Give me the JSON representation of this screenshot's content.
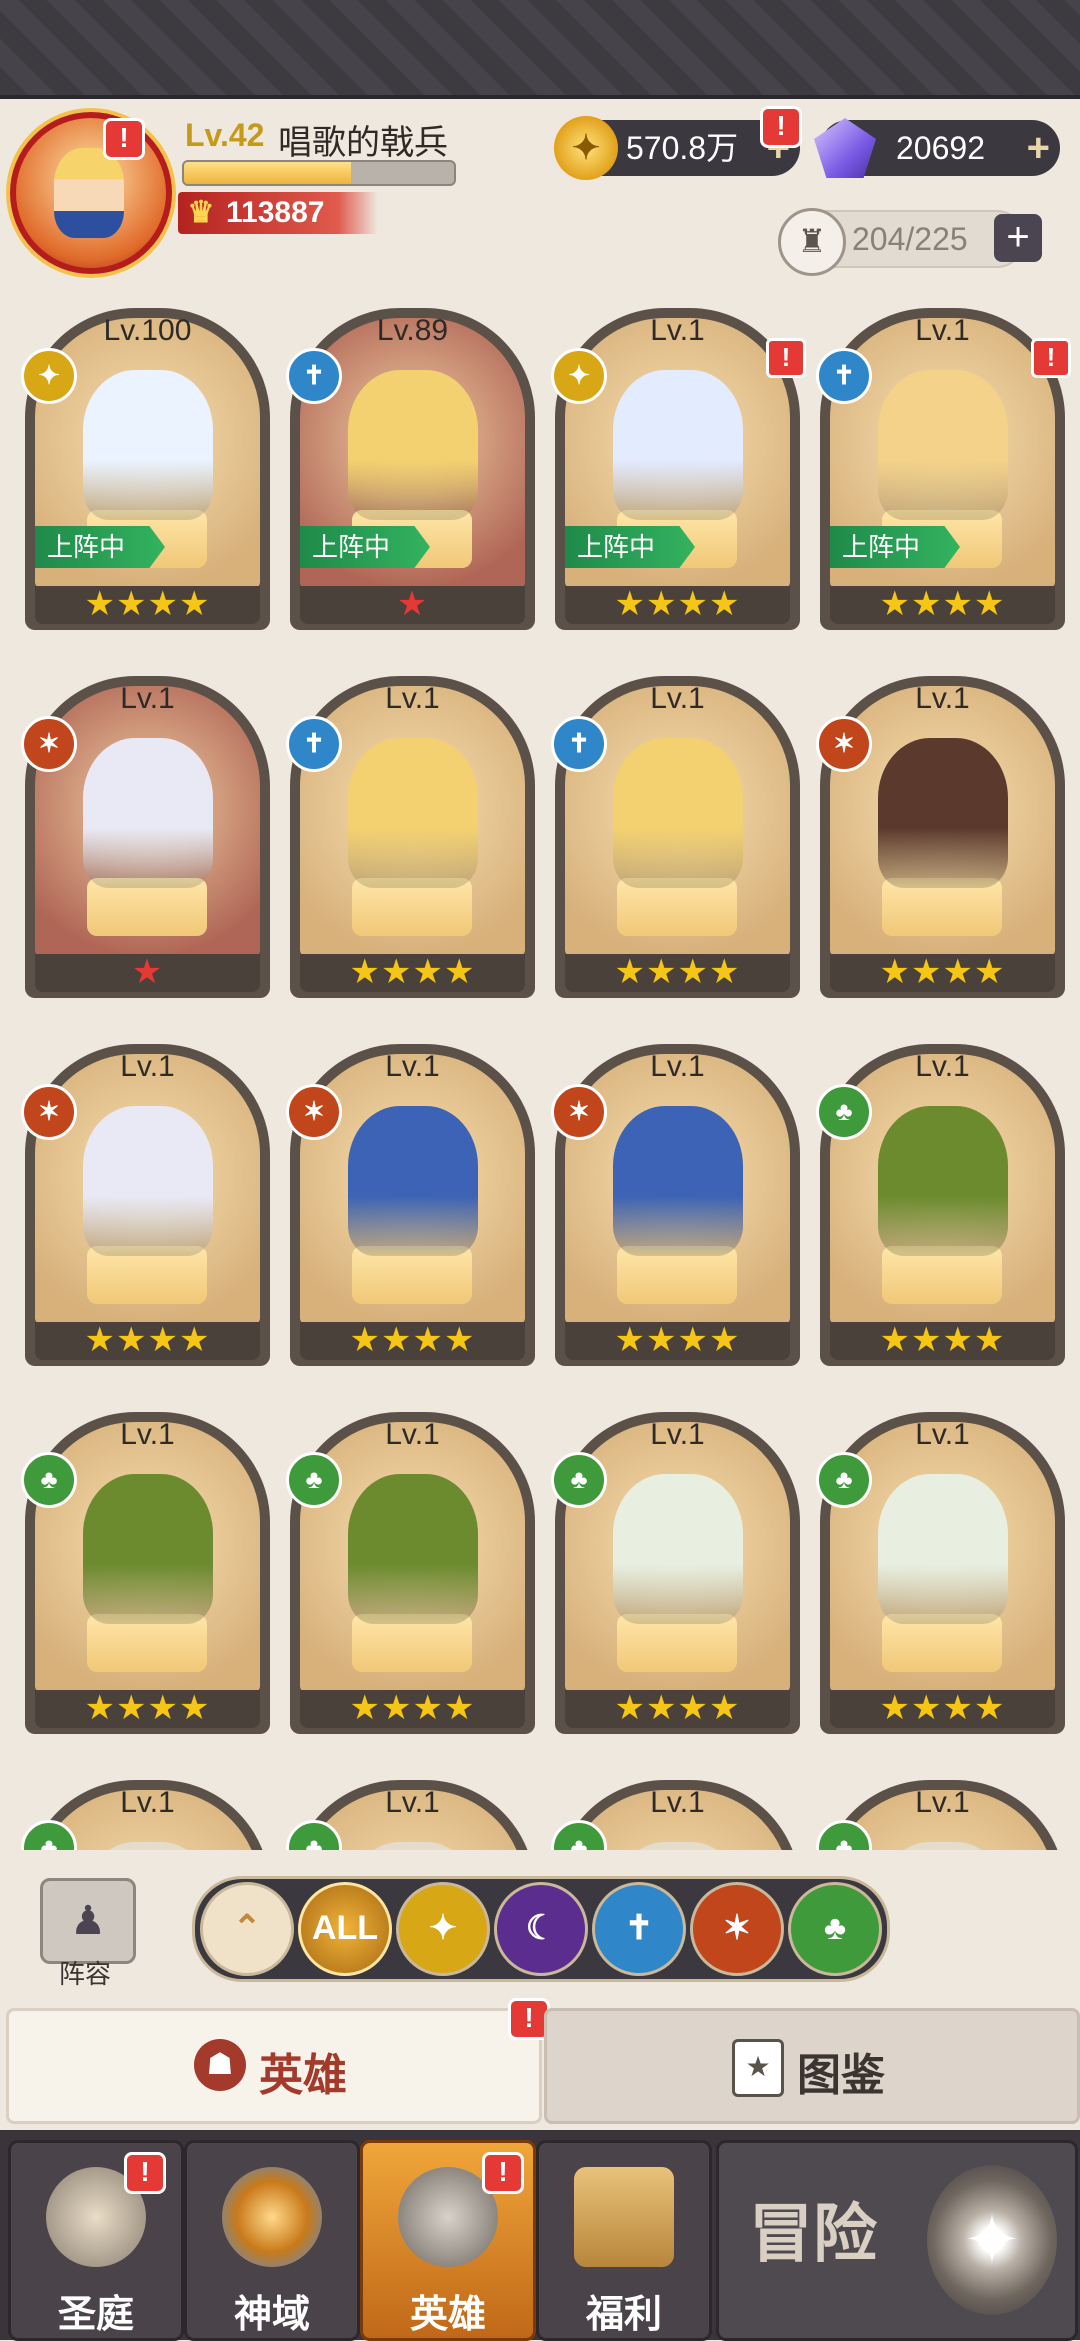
{
  "player": {
    "level": "Lv.42",
    "name": "唱歌的戟兵",
    "xp_fraction": 0.62,
    "power": "113887"
  },
  "resources": {
    "gold": "570.8万",
    "gems": "20692",
    "capacity": "204/225"
  },
  "heroes": [
    {
      "level": "Lv.100",
      "faction": "light",
      "deployed_label": "上阵中",
      "stars": "★★★★",
      "alert": false,
      "color": "#eaf3ff"
    },
    {
      "level": "Lv.89",
      "faction": "order",
      "deployed_label": "上阵中",
      "stars": "★",
      "alert": false,
      "color": "#f3d170"
    },
    {
      "level": "Lv.1",
      "faction": "light",
      "deployed_label": "上阵中",
      "stars": "★★★★",
      "alert": true,
      "color": "#e3ebff"
    },
    {
      "level": "Lv.1",
      "faction": "order",
      "deployed_label": "上阵中",
      "stars": "★★★★",
      "alert": true,
      "color": "#f4d28a"
    },
    {
      "level": "Lv.1",
      "faction": "beast",
      "deployed_label": "",
      "stars": "★",
      "alert": false,
      "color": "#e9e9f5"
    },
    {
      "level": "Lv.1",
      "faction": "order",
      "deployed_label": "",
      "stars": "★★★★",
      "alert": false,
      "color": "#f3d170"
    },
    {
      "level": "Lv.1",
      "faction": "order",
      "deployed_label": "",
      "stars": "★★★★",
      "alert": false,
      "color": "#f3d170"
    },
    {
      "level": "Lv.1",
      "faction": "beast",
      "deployed_label": "",
      "stars": "★★★★",
      "alert": false,
      "color": "#5b3a2d"
    },
    {
      "level": "Lv.1",
      "faction": "beast",
      "deployed_label": "",
      "stars": "★★★★",
      "alert": false,
      "color": "#e9e9f5"
    },
    {
      "level": "Lv.1",
      "faction": "beast",
      "deployed_label": "",
      "stars": "★★★★",
      "alert": false,
      "color": "#3c63b5"
    },
    {
      "level": "Lv.1",
      "faction": "beast",
      "deployed_label": "",
      "stars": "★★★★",
      "alert": false,
      "color": "#3c63b5"
    },
    {
      "level": "Lv.1",
      "faction": "nature",
      "deployed_label": "",
      "stars": "★★★★",
      "alert": false,
      "color": "#6b8b2e"
    },
    {
      "level": "Lv.1",
      "faction": "nature",
      "deployed_label": "",
      "stars": "★★★★",
      "alert": false,
      "color": "#6b8b2e"
    },
    {
      "level": "Lv.1",
      "faction": "nature",
      "deployed_label": "",
      "stars": "★★★★",
      "alert": false,
      "color": "#6b8b2e"
    },
    {
      "level": "Lv.1",
      "faction": "nature",
      "deployed_label": "",
      "stars": "★★★★",
      "alert": false,
      "color": "#e8efe1"
    },
    {
      "level": "Lv.1",
      "faction": "nature",
      "deployed_label": "",
      "stars": "★★★★",
      "alert": false,
      "color": "#e8efe1"
    },
    {
      "level": "Lv.1",
      "faction": "nature",
      "deployed_label": "",
      "stars": "",
      "alert": false,
      "color": "#e6dccb"
    },
    {
      "level": "Lv.1",
      "faction": "nature",
      "deployed_label": "",
      "stars": "",
      "alert": false,
      "color": "#e6dccb"
    },
    {
      "level": "Lv.1",
      "faction": "nature",
      "deployed_label": "",
      "stars": "",
      "alert": false,
      "color": "#e6dccb"
    },
    {
      "level": "Lv.1",
      "faction": "nature",
      "deployed_label": "",
      "stars": "",
      "alert": false,
      "color": "#e6dccb"
    }
  ],
  "filters": {
    "formation_label": "阵容",
    "all_label": "ALL"
  },
  "tabs": {
    "heroes": "英雄",
    "codex": "图鉴"
  },
  "nav": {
    "court": "圣庭",
    "divine": "神域",
    "heroes": "英雄",
    "welfare": "福利",
    "adventure": "冒险"
  },
  "faction_colors": {
    "light": "#d7a716",
    "order": "#2f86c8",
    "beast": "#c1461c",
    "nature": "#3e9a3a",
    "dark": "#5b2d8e"
  }
}
